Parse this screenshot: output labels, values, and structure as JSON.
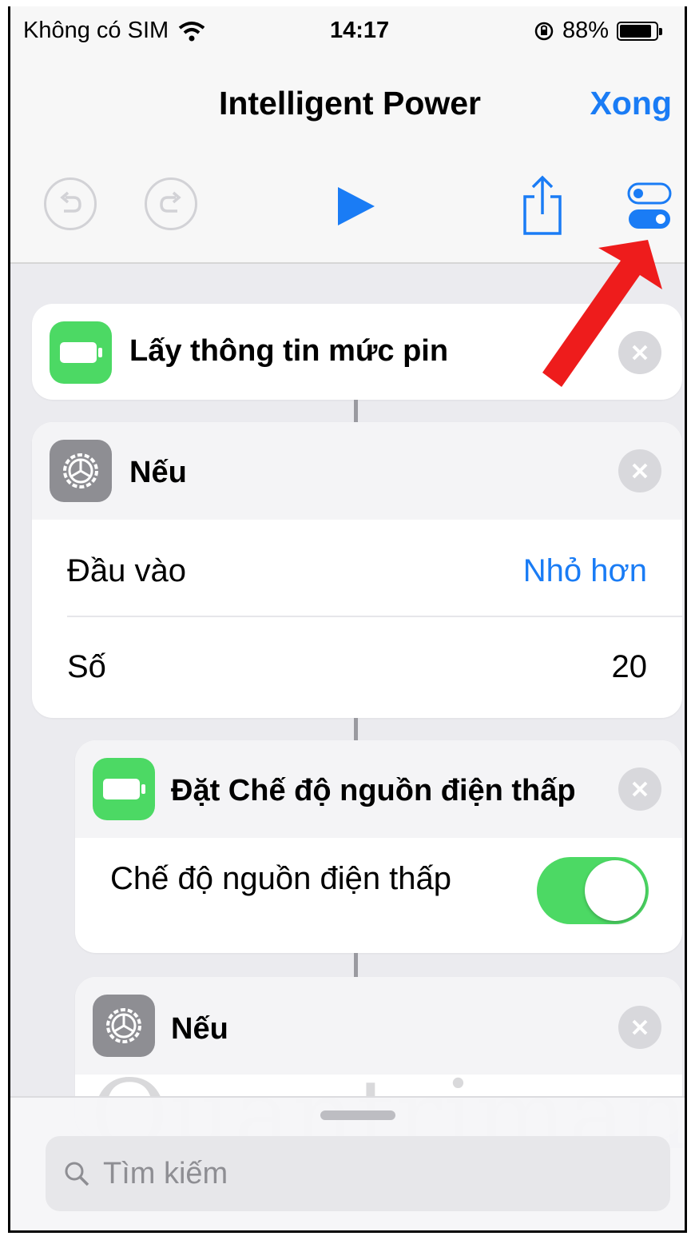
{
  "status_bar": {
    "carrier": "Không có SIM",
    "time": "14:17",
    "battery_percent": "88%",
    "icons": [
      "wifi-icon",
      "orientation-lock-icon",
      "battery-icon"
    ]
  },
  "nav": {
    "title": "Intelligent Power",
    "done_label": "Xong"
  },
  "toolbar": {
    "icons": [
      "undo-icon",
      "redo-icon",
      "play-icon",
      "share-icon",
      "settings-toggle-icon"
    ]
  },
  "actions": [
    {
      "title": "Lấy thông tin mức pin",
      "icon": "battery-icon",
      "icon_color": "#4cd964"
    },
    {
      "title": "Nếu",
      "icon": "gear-icon",
      "icon_color": "#8e8e93",
      "rows": [
        {
          "label": "Đầu vào",
          "value": "Nhỏ hơn"
        },
        {
          "label": "Số",
          "value": "20"
        }
      ]
    },
    {
      "title": "Đặt Chế độ nguồn điện thấp",
      "icon": "battery-icon",
      "icon_color": "#4cd964",
      "rows": [
        {
          "label": "Chế độ nguồn điện thấp",
          "toggle_on": true
        }
      ]
    },
    {
      "title": "Nếu",
      "icon": "gear-icon",
      "icon_color": "#8e8e93"
    }
  ],
  "search": {
    "placeholder": "Tìm kiếm"
  },
  "watermark": "Quantrimang",
  "colors": {
    "accent": "#1a7cf5",
    "green": "#4cd964",
    "annotation_arrow": "#ee1c1c"
  }
}
